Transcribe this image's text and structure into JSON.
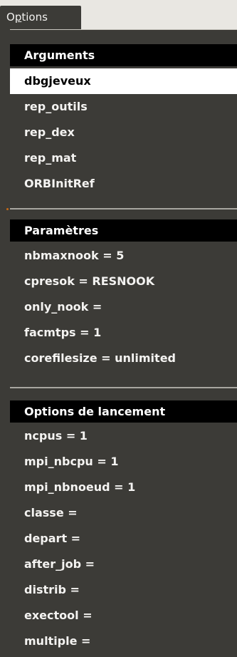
{
  "menubar": {
    "tab_label_prefix": "O",
    "tab_label_mnemonic": "p",
    "tab_label_suffix": "tions"
  },
  "sections": {
    "arguments": {
      "header": "Arguments",
      "items": [
        "dbgjeveux",
        "rep_outils",
        "rep_dex",
        "rep_mat",
        "ORBInitRef"
      ],
      "selected_index": 0
    },
    "parametres": {
      "header": "Paramètres",
      "items": [
        "nbmaxnook = 5",
        "cpresok = RESNOOK",
        "only_nook =",
        "facmtps = 1",
        "corefilesize = unlimited"
      ]
    },
    "lancement": {
      "header": "Options de lancement",
      "items": [
        "ncpus = 1",
        "mpi_nbcpu = 1",
        "mpi_nbnoeud = 1",
        "classe =",
        "depart =",
        "after_job =",
        "distrib =",
        "exectool =",
        "multiple ="
      ]
    }
  },
  "colors": {
    "menu_bg": "#3c3b37",
    "header_bg": "#000000",
    "selected_bg": "#ffffff",
    "accent": "#c86a15"
  }
}
